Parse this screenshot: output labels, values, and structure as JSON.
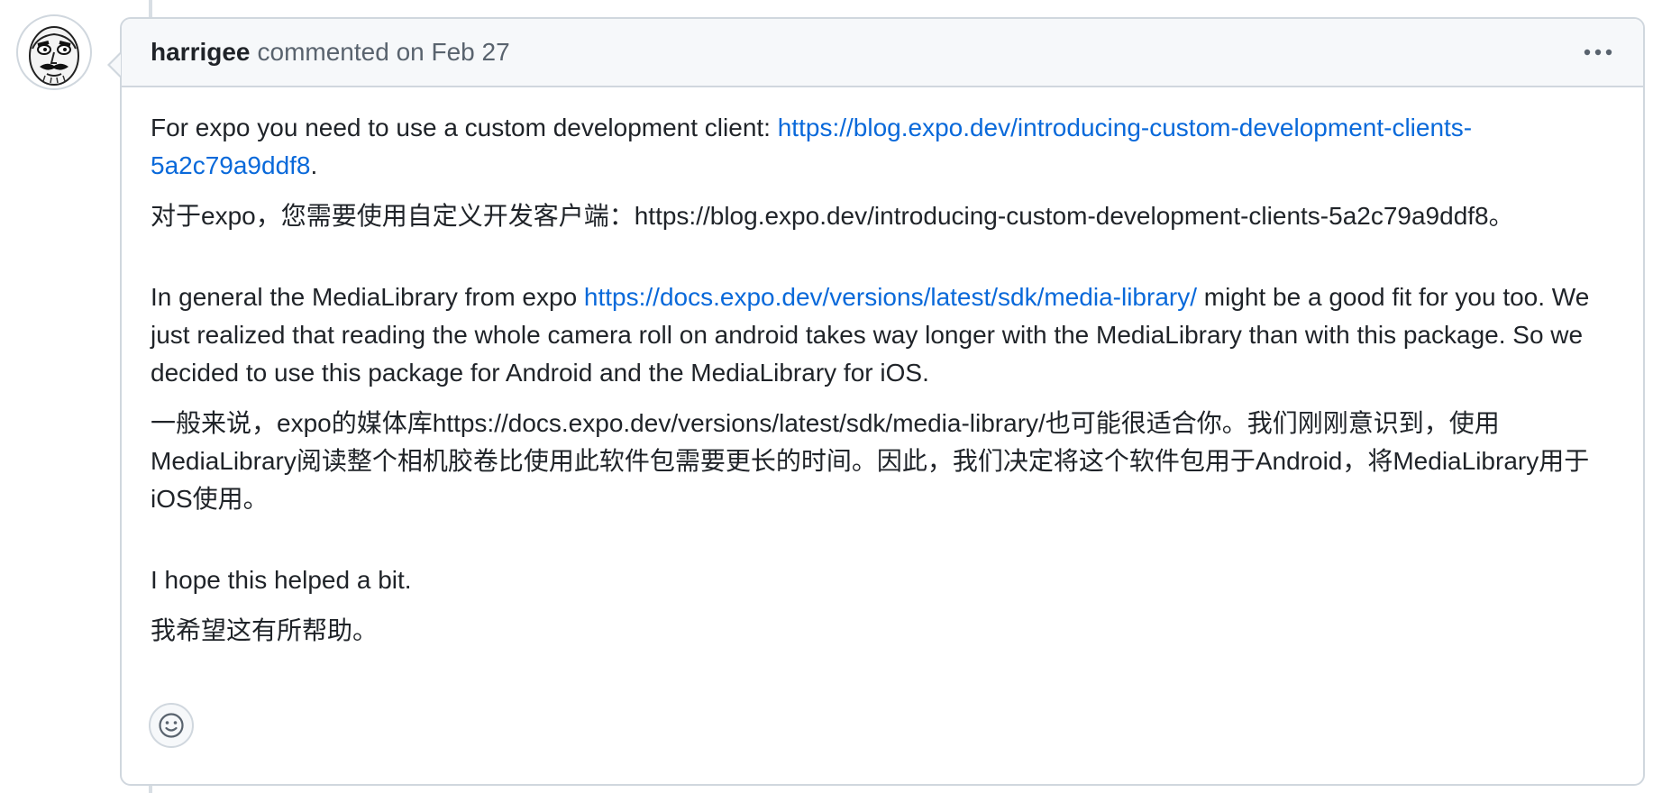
{
  "comment": {
    "author": "harrigee",
    "meta": "commented on Feb 27",
    "menu_icon": "kebab-horizontal-icon",
    "paragraphs": {
      "p1": {
        "text": "For expo you need to use a custom development client: ",
        "link": "https://blog.expo.dev/introducing-custom-development-clients-5a2c79a9ddf8",
        "after": "."
      },
      "p1_zh": "对于expo，您需要使用自定义开发客户端：https://blog.expo.dev/introducing-custom-development-clients-5a2c79a9ddf8。",
      "p2": {
        "before": "In general the MediaLibrary from expo ",
        "link": "https://docs.expo.dev/versions/latest/sdk/media-library/",
        "after": " might be a good fit for you too. We just realized that reading the whole camera roll on android takes way longer with the MediaLibrary than with this package. So we decided to use this package for Android and the MediaLibrary for iOS."
      },
      "p2_zh": "一般来说，expo的媒体库https://docs.expo.dev/versions/latest/sdk/media-library/也可能很适合你。我们刚刚意识到，使用MediaLibrary阅读整个相机胶卷比使用此软件包需要更长的时间。因此，我们决定将这个软件包用于Android，将MediaLibrary用于iOS使用。",
      "p3": "I hope this helped a bit.",
      "p3_zh": "我希望这有所帮助。"
    },
    "reaction_icon": "smiley-icon"
  },
  "colors": {
    "link": "#0969da",
    "border": "#d0d7de",
    "header_bg": "#f6f8fa",
    "muted_text": "#59636e",
    "text": "#1f2328"
  }
}
